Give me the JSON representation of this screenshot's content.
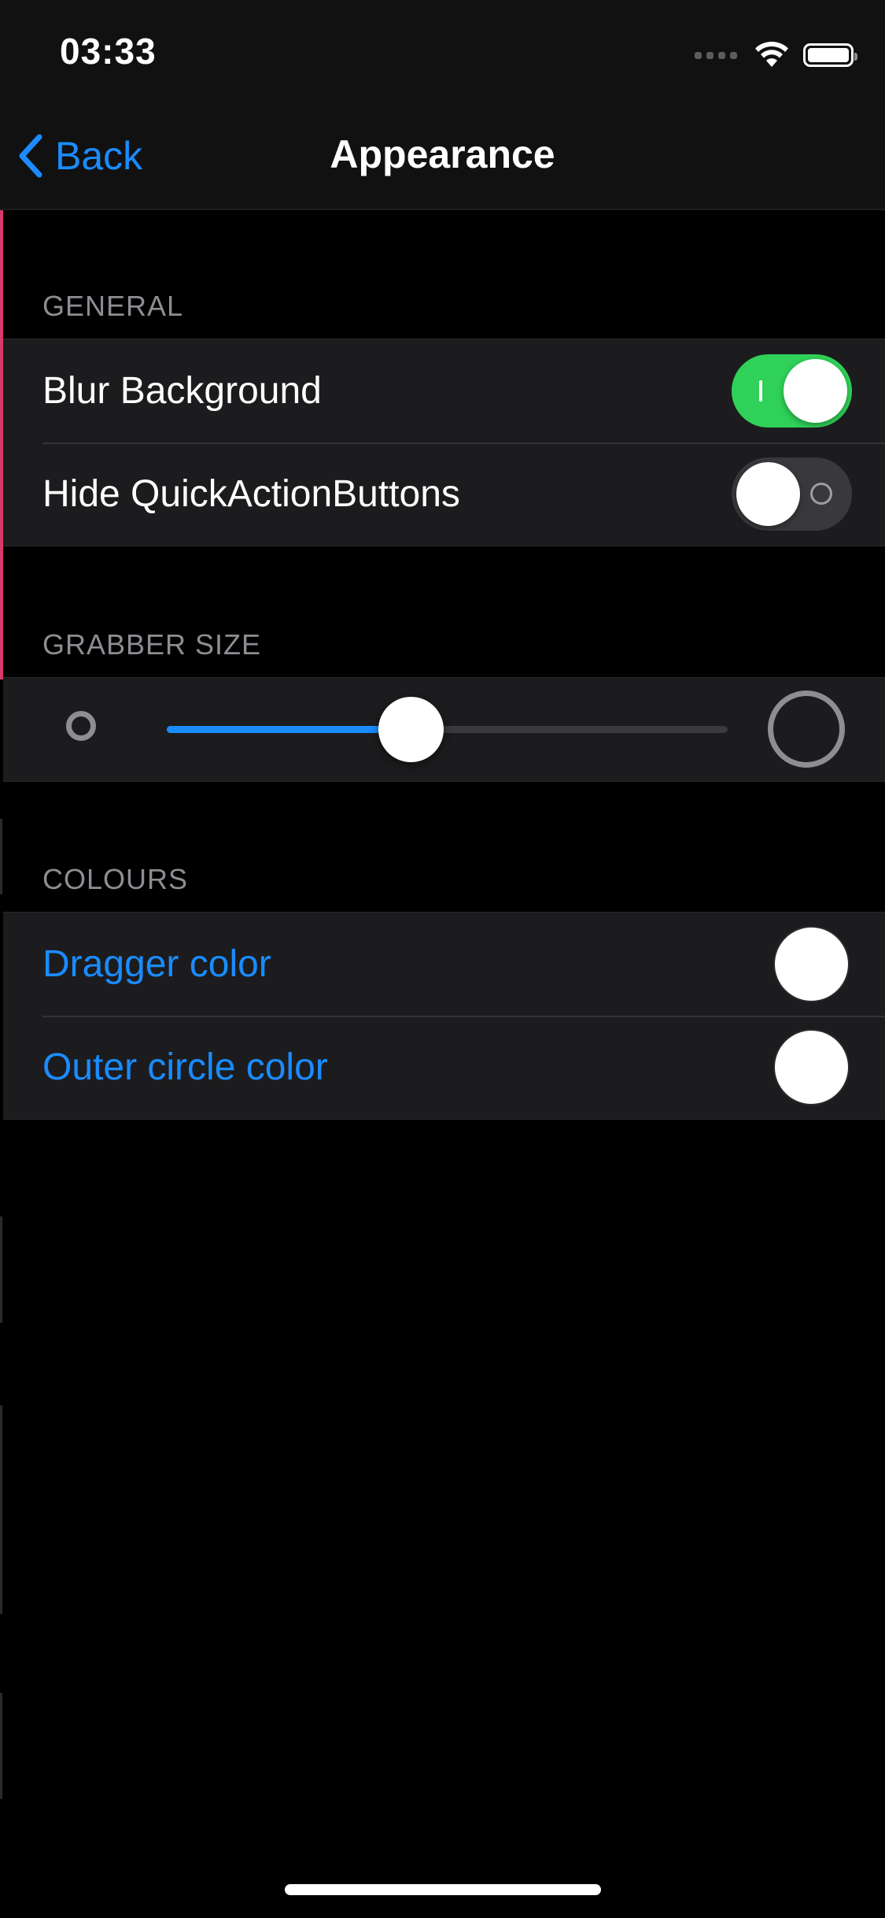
{
  "status_bar": {
    "time": "03:33",
    "wifi_icon": "wifi-icon",
    "battery_icon": "battery-icon",
    "battery_level": 1.0
  },
  "nav": {
    "back_label": "Back",
    "title": "Appearance"
  },
  "sections": {
    "general": {
      "header": "GENERAL",
      "rows": [
        {
          "label": "Blur Background",
          "enabled": true
        },
        {
          "label": "Hide QuickActionButtons",
          "enabled": false
        }
      ]
    },
    "grabber_size": {
      "header": "GRABBER SIZE",
      "slider_value": 0.435
    },
    "colours": {
      "header": "COLOURS",
      "rows": [
        {
          "label": "Dragger color",
          "color": "#ffffff"
        },
        {
          "label": "Outer circle color",
          "color": "#ffffff"
        }
      ]
    }
  },
  "colors": {
    "accent": "#1a8cff",
    "toggle_on": "#30d158",
    "toggle_off": "#39393d",
    "background": "#000000",
    "cell": "#1c1c1e"
  }
}
